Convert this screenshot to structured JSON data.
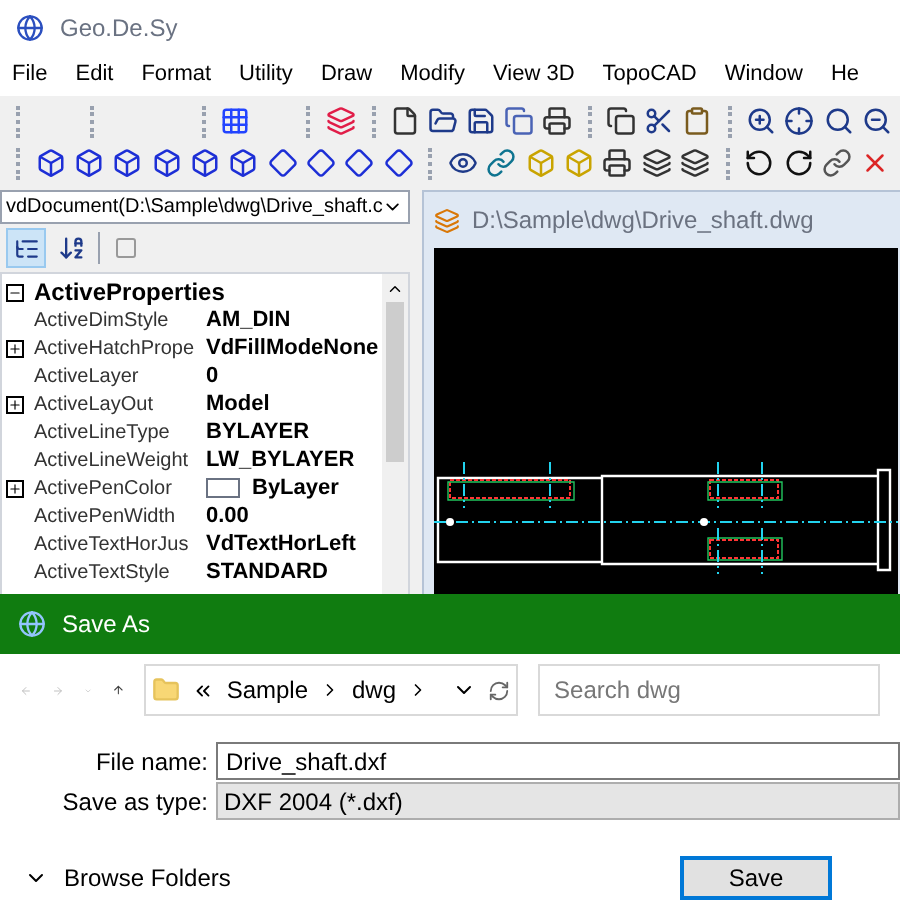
{
  "app": {
    "title": "Geo.De.Sy"
  },
  "menu": [
    "File",
    "Edit",
    "Format",
    "Utility",
    "Draw",
    "Modify",
    "View 3D",
    "TopoCAD",
    "Window",
    "He"
  ],
  "document_selector": {
    "value": "vdDocument(D:\\Sample\\dwg\\Drive_shaft.c"
  },
  "properties": {
    "group": {
      "label": "ActiveProperties",
      "expanded": true
    },
    "rows": [
      {
        "name": "ActiveDimStyle",
        "value": "AM_DIN",
        "kind": "text",
        "expandable": false
      },
      {
        "name": "ActiveHatchPrope",
        "value": "VdFillModeNone",
        "kind": "text",
        "expandable": true
      },
      {
        "name": "ActiveLayer",
        "value": "0",
        "kind": "text",
        "expandable": false
      },
      {
        "name": "ActiveLayOut",
        "value": "Model",
        "kind": "text",
        "expandable": true
      },
      {
        "name": "ActiveLineType",
        "value": "BYLAYER",
        "kind": "text",
        "expandable": false
      },
      {
        "name": "ActiveLineWeight",
        "value": "LW_BYLAYER",
        "kind": "text",
        "expandable": false
      },
      {
        "name": "ActivePenColor",
        "value": "ByLayer",
        "kind": "color",
        "expandable": true
      },
      {
        "name": "ActivePenWidth",
        "value": "0.00",
        "kind": "text",
        "expandable": false
      },
      {
        "name": "ActiveTextHorJus",
        "value": "VdTextHorLeft",
        "kind": "text",
        "expandable": false
      },
      {
        "name": "ActiveTextStyle",
        "value": "STANDARD",
        "kind": "text",
        "expandable": false
      }
    ]
  },
  "drawing_window": {
    "title": "D:\\Sample\\dwg\\Drive_shaft.dwg"
  },
  "dialog": {
    "title": "Save As",
    "breadcrumb": [
      "Sample",
      "dwg"
    ],
    "search": {
      "placeholder": "Search dwg"
    },
    "fields": [
      {
        "label": "File name:",
        "value": "Drive_shaft.dxf",
        "kind": "text"
      },
      {
        "label": "Save as type:",
        "value": "DXF 2004 (*.dxf)",
        "kind": "select"
      }
    ],
    "browse": {
      "label": "Browse Folders",
      "expanded": false
    },
    "buttons": [
      "Save"
    ]
  }
}
